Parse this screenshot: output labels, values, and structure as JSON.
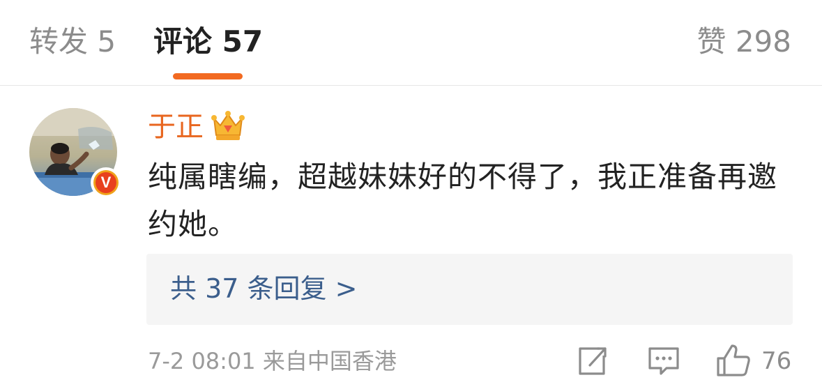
{
  "tabs": {
    "repost": "转发 5",
    "comments": "评论 57",
    "likes": "赞 298"
  },
  "comment": {
    "username": "于正",
    "badge_letter": "V",
    "text": "纯属瞎编，超越妹妹好的不得了，我正准备再邀约她。",
    "replies_label": "共 37 条回复 >",
    "meta": "7-2 08:01 来自中国香港",
    "like_count": "76"
  },
  "colors": {
    "accent": "#f26a21",
    "username": "#e8661f",
    "link": "#3b5e8c"
  },
  "icons": {
    "crown": "crown-icon",
    "share": "share-icon",
    "reply": "reply-icon",
    "like": "thumbs-up-icon",
    "verified": "verified-badge-icon"
  }
}
